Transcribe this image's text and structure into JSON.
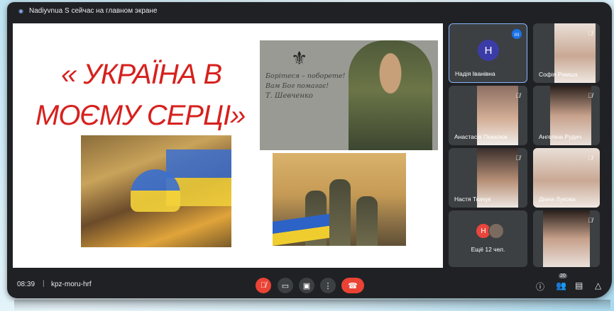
{
  "topbar": {
    "status": "Nadiyvnua S сейчас на главном экране"
  },
  "slide": {
    "title_line1": "« УКРАЇНА В",
    "title_line2": "МОЄМУ СЕРЦІ»",
    "verse_line1": "Борітеся – поборете!",
    "verse_line2": "Вам Бог помагає!",
    "verse_sig": "Т. Шевченко"
  },
  "participants": [
    {
      "name": "Надія Іванівна",
      "avatar_letter": "H"
    },
    {
      "name": "Софія Римша"
    },
    {
      "name": "Анастасія Пєкилюк"
    },
    {
      "name": "Ангеліна Рудич"
    },
    {
      "name": "Настя Ткачук"
    },
    {
      "name": "Діана Лукова"
    }
  ],
  "more_tile": {
    "avatar_letter": "H",
    "label": "Ещё 12 чел."
  },
  "bottombar": {
    "time": "08:39",
    "meeting_code": "kpz-moru-hrf",
    "people_count": "20"
  },
  "colors": {
    "accent_red": "#ea4335",
    "title_red": "#d6211e",
    "tile_bg": "#3c4043",
    "frame_bg": "#202124"
  }
}
